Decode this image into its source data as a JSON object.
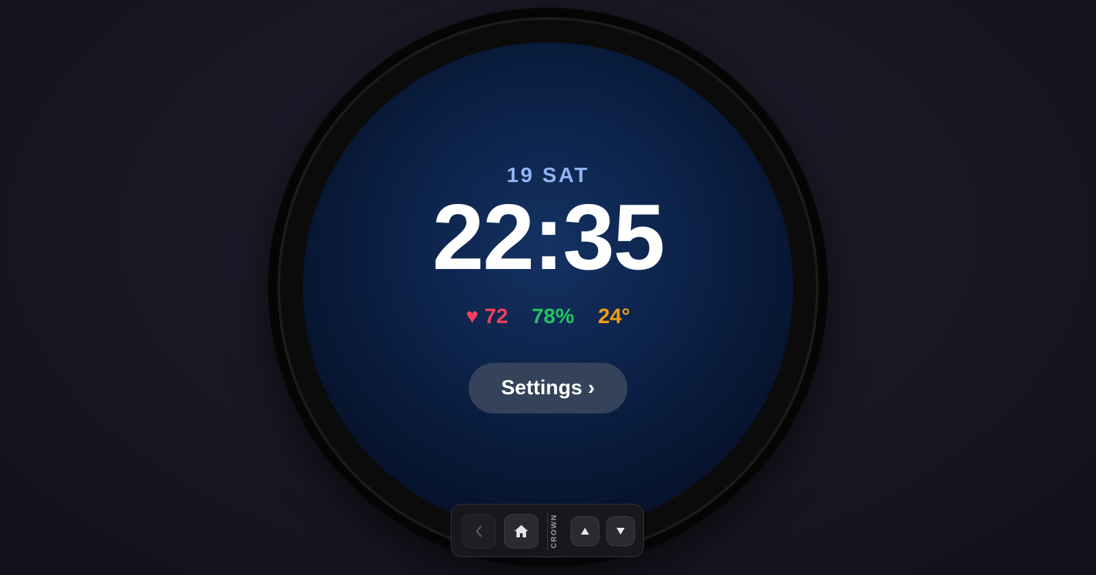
{
  "watch": {
    "date": "19 SAT",
    "time": "22:35",
    "stats": {
      "heart_icon": "♥",
      "heart_rate": "72",
      "battery": "78%",
      "temperature": "24°"
    },
    "settings_label": "Settings ›"
  },
  "controls": {
    "crown_label": "CROWN",
    "icons": {
      "back": "chevron-left-icon",
      "home": "home-icon",
      "up": "triangle-up-icon",
      "down": "triangle-down-icon"
    }
  },
  "colors": {
    "date": "#8fb4f2",
    "heart_rate": "#f43f5e",
    "battery": "#22c55e",
    "temperature": "#f59e0b",
    "button": "#34435a"
  }
}
